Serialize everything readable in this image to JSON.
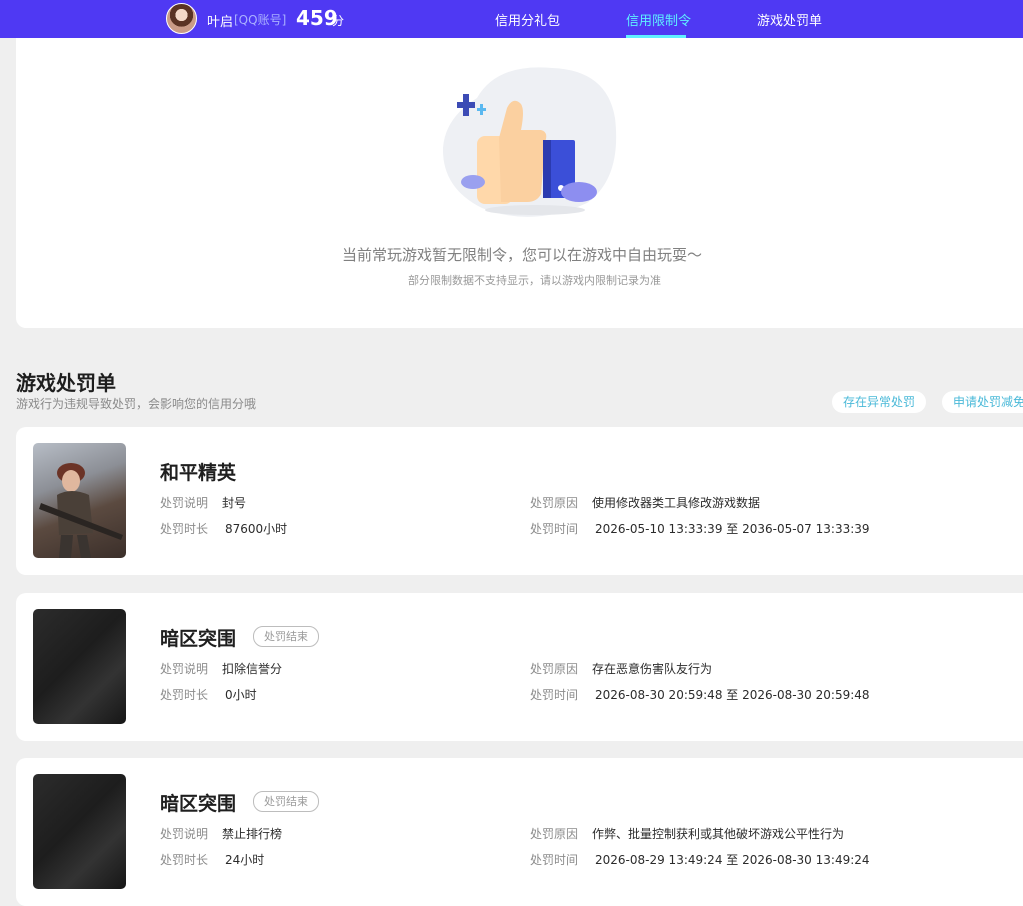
{
  "header": {
    "user_name": "叶启",
    "account_type": "[QQ账号]",
    "score": "459",
    "score_unit": "分",
    "tabs": [
      {
        "label": "信用分礼包",
        "active": false
      },
      {
        "label": "信用限制令",
        "active": true
      },
      {
        "label": "游戏处罚单",
        "active": false
      }
    ],
    "colors": {
      "bar": "#4f39f3",
      "active_tab": "#5ff0ff"
    }
  },
  "restriction": {
    "empty_message": "当前常玩游戏暂无限制令，您可以在游戏中自由玩耍～",
    "note": "部分限制数据不支持显示，请以游戏内限制记录为准"
  },
  "penalty": {
    "title": "游戏处罚单",
    "subtitle": "游戏行为违规导致处罚，会影响您的信用分哦",
    "actions": [
      "存在异常处罚",
      "申请处罚减免"
    ],
    "labels": {
      "desc": "处罚说明",
      "duration": "处罚时长",
      "reason": "处罚原因",
      "time": "处罚时间"
    },
    "records": [
      {
        "game": "和平精英",
        "status": "",
        "desc": "封号",
        "duration": "87600小时",
        "reason": "使用修改器类工具修改游戏数据",
        "time": "2026-05-10 13:33:39 至 2036-05-07 13:33:39"
      },
      {
        "game": "暗区突围",
        "status": "处罚结束",
        "desc": "扣除信誉分",
        "duration": "0小时",
        "reason": "存在恶意伤害队友行为",
        "time": "2026-08-30 20:59:48 至 2026-08-30 20:59:48"
      },
      {
        "game": "暗区突围",
        "status": "处罚结束",
        "desc": "禁止排行榜",
        "duration": "24小时",
        "reason": "作弊、批量控制获利或其他破坏游戏公平性行为",
        "time": "2026-08-29 13:49:24 至 2026-08-30 13:49:24"
      }
    ]
  }
}
